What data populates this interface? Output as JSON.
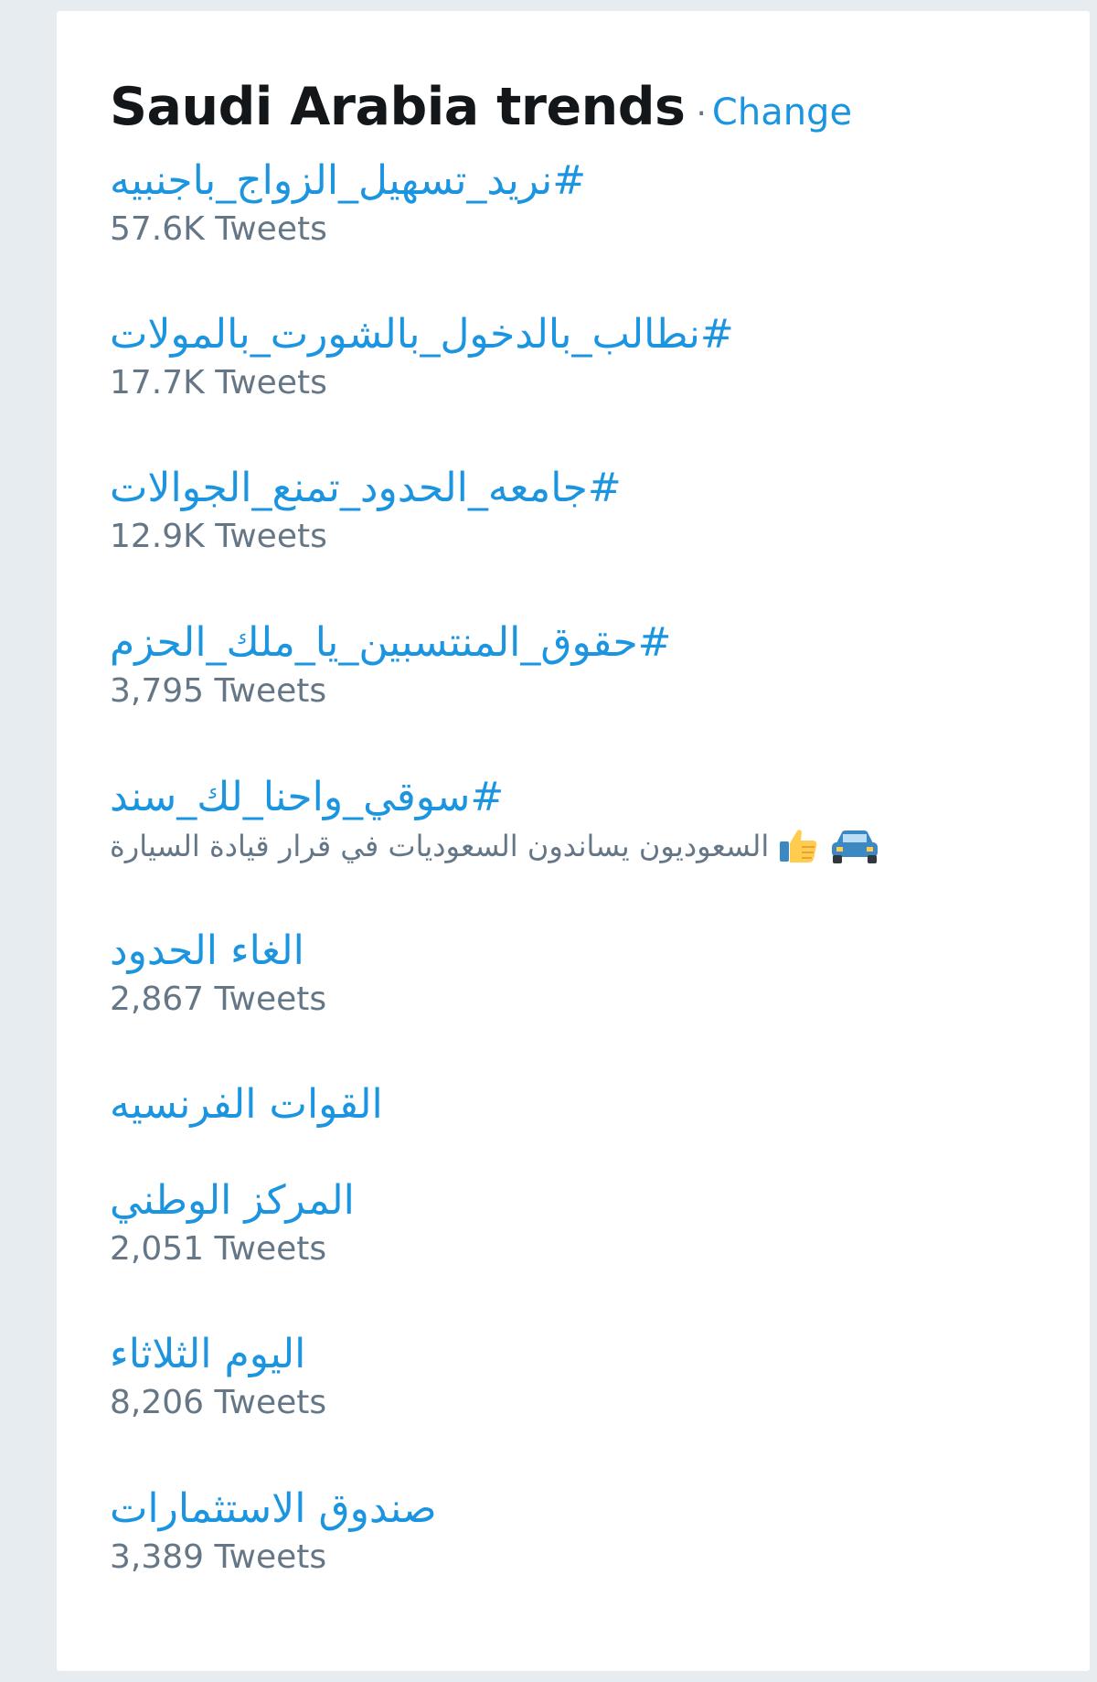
{
  "header": {
    "title": "Saudi Arabia trends",
    "separator": "·",
    "change_label": "Change"
  },
  "trends": [
    {
      "name": "#نريد_تسهيل_الزواج_باجنبيه",
      "count": "57.6K Tweets"
    },
    {
      "name": "#نطالب_بالدخول_بالشورت_بالمولات",
      "count": "17.7K Tweets"
    },
    {
      "name": "#جامعه_الحدود_تمنع_الجوالات",
      "count": "12.9K Tweets"
    },
    {
      "name": "#حقوق_المنتسبين_يا_ملك_الحزم",
      "count": "3,795 Tweets"
    },
    {
      "name": "#سوقي_واحنا_لك_سند",
      "context": "السعوديون يساندون السعوديات في قرار قيادة السيارة",
      "context_icons": [
        "car-emoji",
        "thumbs-up-emoji"
      ]
    },
    {
      "name": "الغاء الحدود",
      "count": "2,867 Tweets"
    },
    {
      "name": "القوات الفرنسيه"
    },
    {
      "name": "المركز الوطني",
      "count": "2,051 Tweets"
    },
    {
      "name": "اليوم الثلاثاء",
      "count": "8,206 Tweets"
    },
    {
      "name": "صندوق الاستثمارات",
      "count": "3,389 Tweets"
    }
  ],
  "colors": {
    "page_background": "#e6ecf0",
    "card_background": "#ffffff",
    "title": "#14171a",
    "link": "#1b95e0",
    "secondary_text": "#657786"
  }
}
